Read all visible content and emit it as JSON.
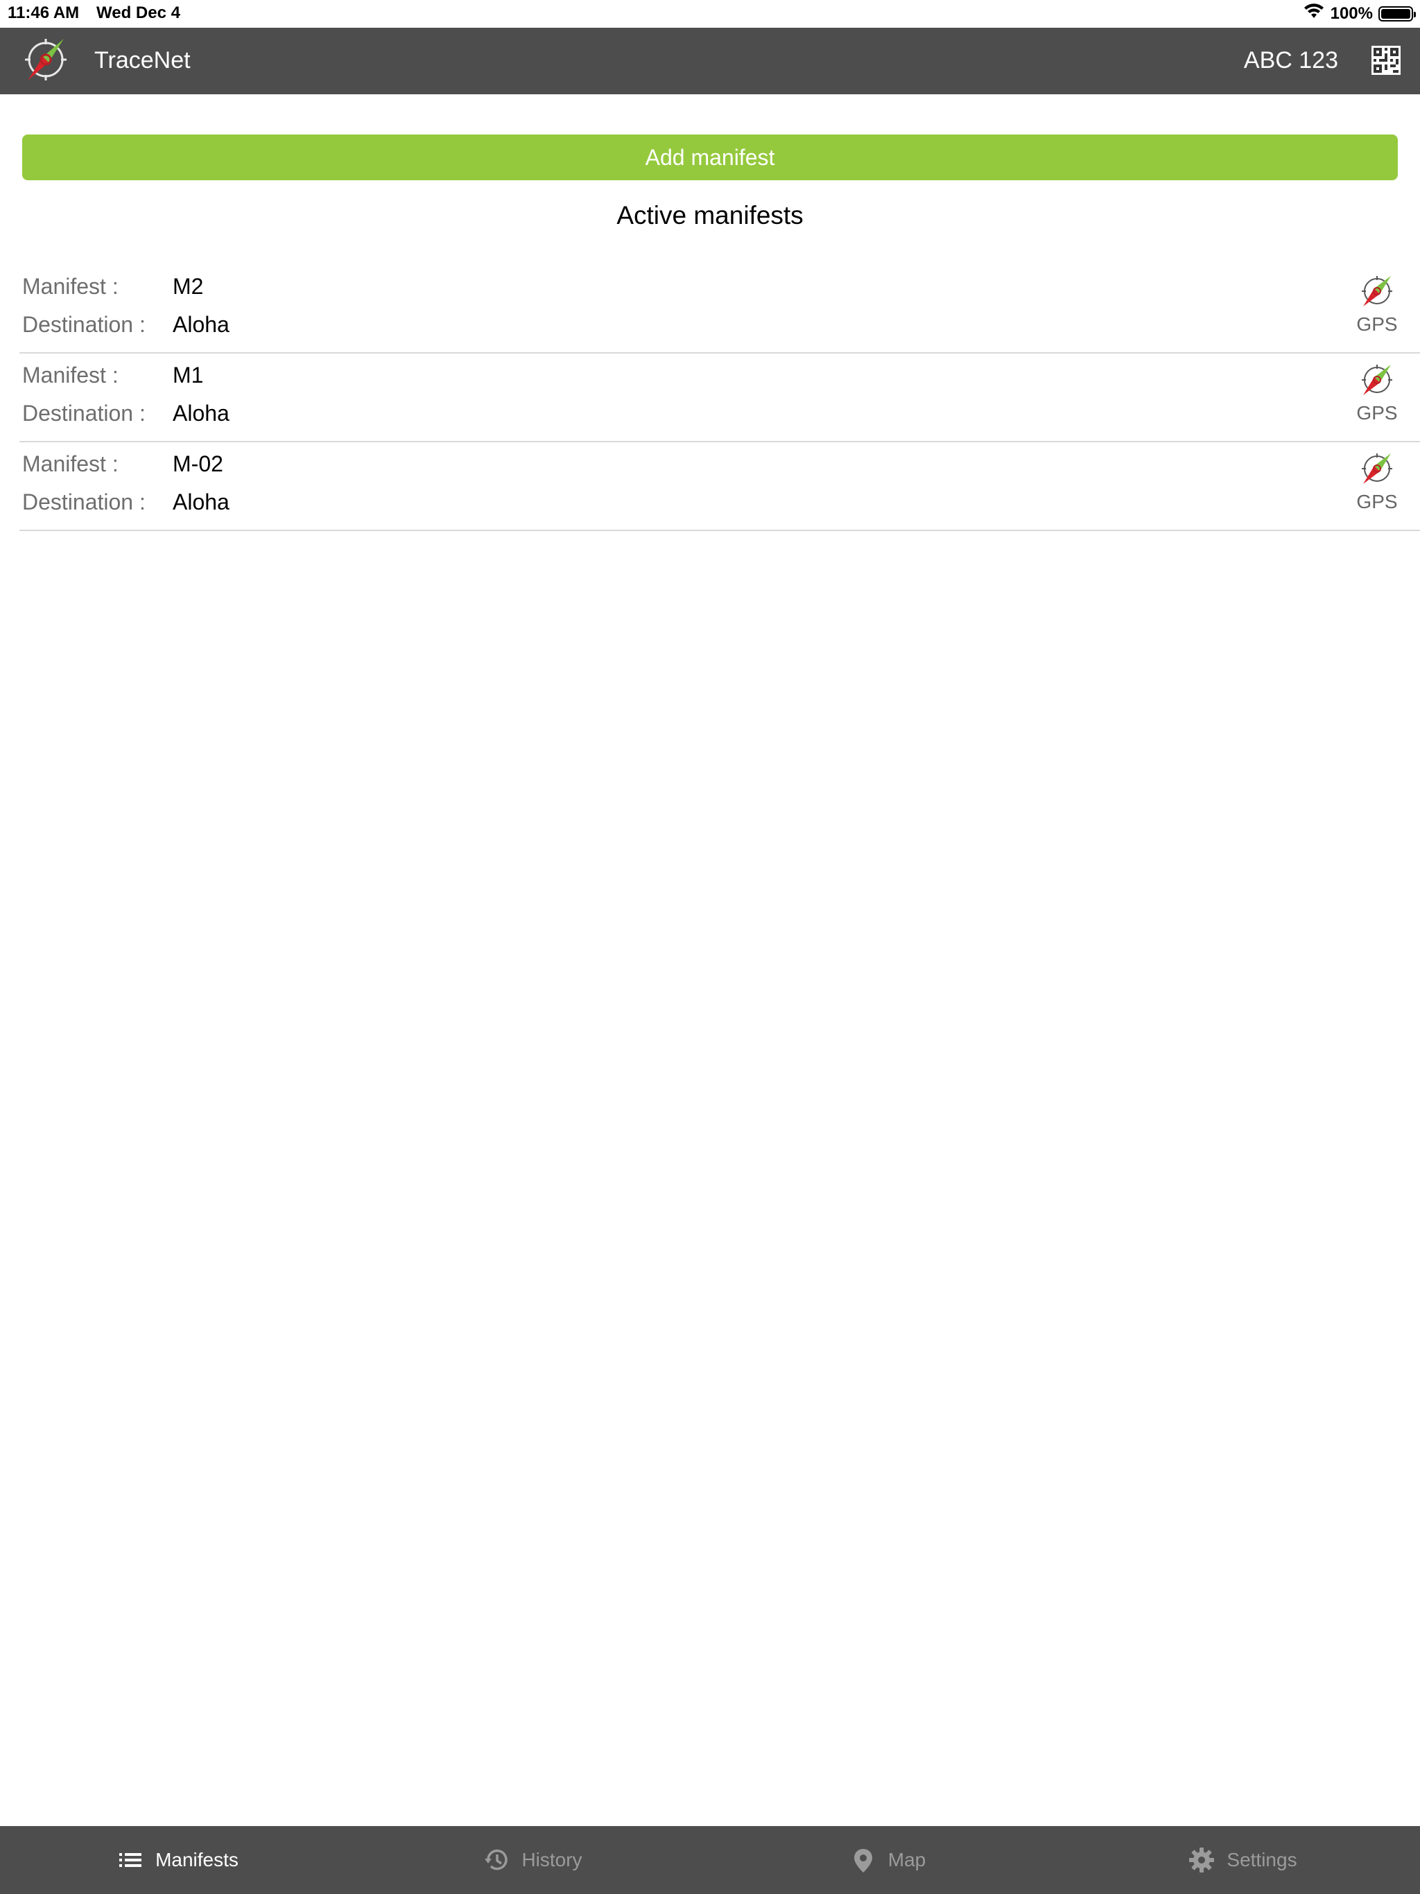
{
  "status_bar": {
    "time": "11:46 AM",
    "date": "Wed Dec 4",
    "battery": "100%",
    "battery_level": 1.0
  },
  "header": {
    "title": "TraceNet",
    "vehicle_id": "ABC 123",
    "logo_icon": "compass-logo-icon",
    "qr_icon": "qr-code-icon"
  },
  "main": {
    "add_button_label": "Add manifest",
    "section_title": "Active manifests",
    "manifest_label": "Manifest :",
    "destination_label": "Destination :",
    "gps_label": "GPS",
    "manifests": [
      {
        "manifest": "M2",
        "destination": "Aloha"
      },
      {
        "manifest": "M1",
        "destination": "Aloha"
      },
      {
        "manifest": "M-02",
        "destination": "Aloha"
      }
    ]
  },
  "tab_bar": {
    "tabs": [
      {
        "label": "Manifests",
        "icon": "list-icon",
        "active": true
      },
      {
        "label": "History",
        "icon": "history-icon",
        "active": false
      },
      {
        "label": "Map",
        "icon": "map-pin-icon",
        "active": false
      },
      {
        "label": "Settings",
        "icon": "gear-icon",
        "active": false
      }
    ]
  },
  "colors": {
    "header_bg": "#4d4d4d",
    "accent_green": "#95c93d",
    "label_gray": "#6e6e6e",
    "divider": "#d9d9d9"
  }
}
